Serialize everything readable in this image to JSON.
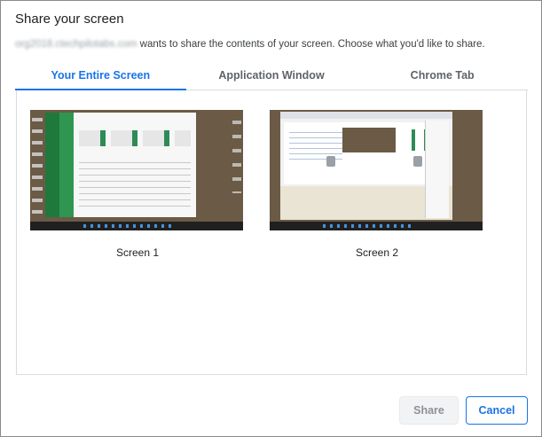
{
  "dialog": {
    "title": "Share your screen",
    "origin": "org2018.ctechpilotabs.com",
    "description": " wants to share the contents of your screen. Choose what you'd like to share."
  },
  "tabs": [
    {
      "label": "Your Entire Screen",
      "active": true
    },
    {
      "label": "Application Window",
      "active": false
    },
    {
      "label": "Chrome Tab",
      "active": false
    }
  ],
  "screens": [
    {
      "label": "Screen 1"
    },
    {
      "label": "Screen 2"
    }
  ],
  "buttons": {
    "share": "Share",
    "cancel": "Cancel"
  },
  "colors": {
    "accent": "#1a73e8",
    "desktop_background": "#6b5a45"
  }
}
